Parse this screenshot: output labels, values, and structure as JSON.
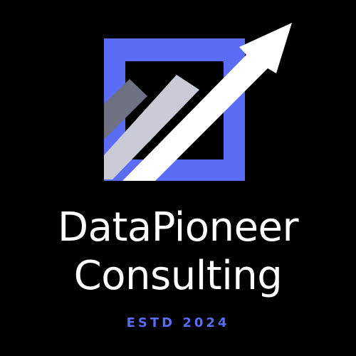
{
  "brand": {
    "name_line_1": "DataPioneer",
    "name_line_2": "Consulting",
    "tagline": "ESTD 2024"
  },
  "logo": {
    "icon": "growth-arrow-icon",
    "square_color": "#5b6cf5",
    "arrow_color": "#ffffff",
    "bar_light_color": "#c9ccd6",
    "bar_dark_color": "#6e7181"
  },
  "colors": {
    "background": "#000000",
    "text": "#ffffff",
    "accent": "#5b6cf5"
  }
}
